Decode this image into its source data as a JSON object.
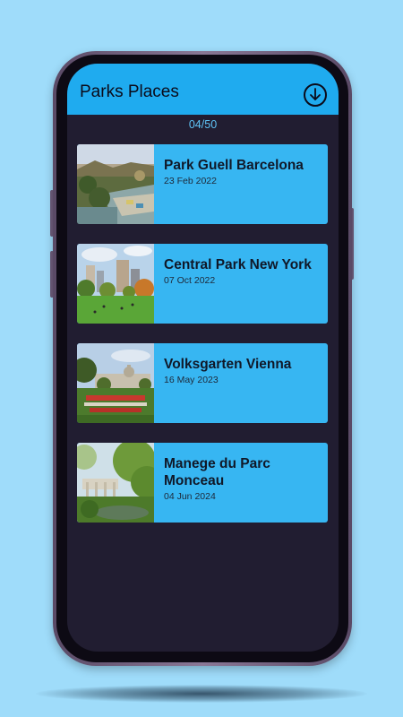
{
  "app": {
    "title": "Parks Places",
    "download_icon": "download-circle-icon",
    "counter": "04/50"
  },
  "colors": {
    "app_bar": "#1fabef",
    "card": "#37b6f2",
    "screen_bg": "#211d31",
    "counter_text": "#5fc3f6",
    "page_bg": "#9fdcfa"
  },
  "parks": [
    {
      "title": "Park Guell Barcelona",
      "date": "23 Feb 2022"
    },
    {
      "title": "Central Park New York",
      "date": "07 Oct 2022"
    },
    {
      "title": "Volksgarten Vienna",
      "date": "16 May 2023"
    },
    {
      "title": "Manege du Parc Monceau",
      "date": "04 Jun 2024"
    }
  ]
}
